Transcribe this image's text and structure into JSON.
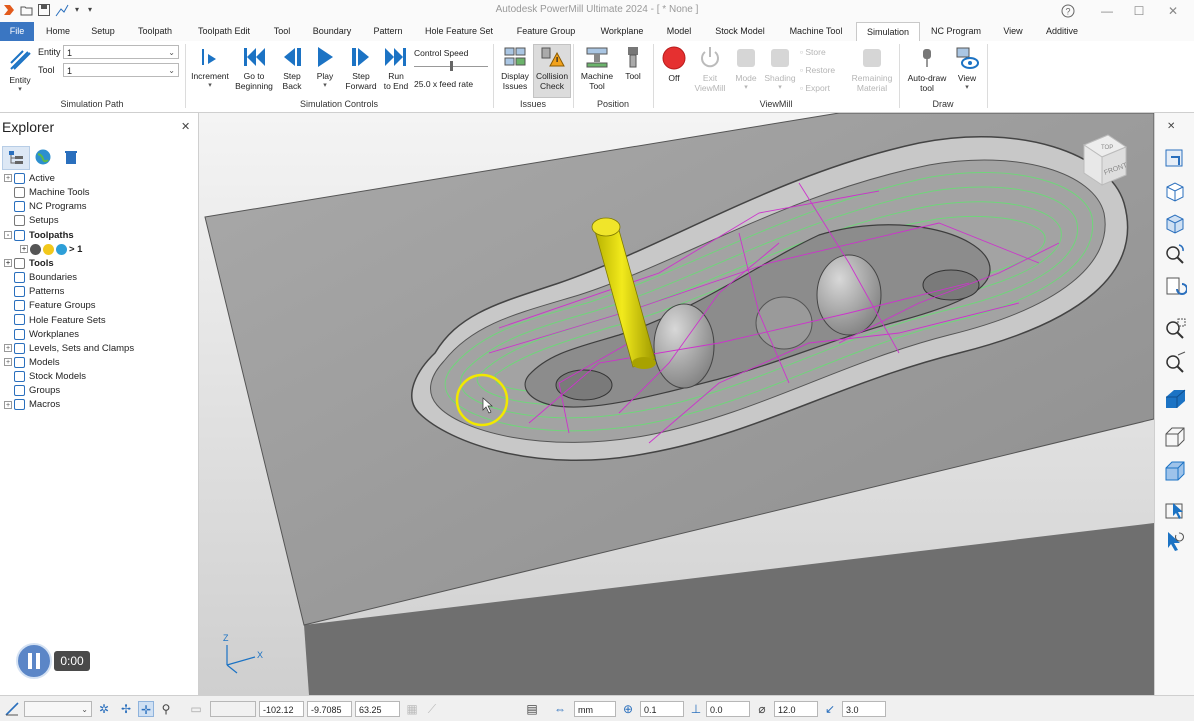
{
  "window": {
    "title": "Autodesk PowerMill Ultimate 2024  -  [ * None ]",
    "quick_access": [
      "app-logo-icon",
      "open-folder-icon",
      "save-icon",
      "graph-icon",
      "dropdown-arrow-icon"
    ],
    "controls": [
      "help-icon",
      "minimize-icon",
      "restore-icon",
      "close-icon"
    ]
  },
  "tabs": [
    {
      "label": "File"
    },
    {
      "label": "Home"
    },
    {
      "label": "Setup"
    },
    {
      "label": "Toolpath"
    },
    {
      "label": "Toolpath Edit"
    },
    {
      "label": "Tool"
    },
    {
      "label": "Boundary"
    },
    {
      "label": "Pattern"
    },
    {
      "label": "Hole Feature Set"
    },
    {
      "label": "Feature Group"
    },
    {
      "label": "Workplane"
    },
    {
      "label": "Model"
    },
    {
      "label": "Stock Model"
    },
    {
      "label": "Machine Tool"
    },
    {
      "label": "Simulation"
    },
    {
      "label": "NC Program"
    },
    {
      "label": "View"
    },
    {
      "label": "Additive"
    }
  ],
  "active_tab": "Simulation",
  "ribbon": {
    "simulation_path": {
      "group_label": "Simulation Path",
      "entity_button": "Entity",
      "entity_label": "Entity",
      "entity_value": "1",
      "tool_label": "Tool",
      "tool_value": "1"
    },
    "simulation_controls": {
      "group_label": "Simulation Controls",
      "increment": "Increment",
      "go_to_beginning": [
        "Go to",
        "Beginning"
      ],
      "step_back": [
        "Step",
        "Back"
      ],
      "play": "Play",
      "step_forward": [
        "Step",
        "Forward"
      ],
      "run_to_end": [
        "Run",
        "to End"
      ],
      "control_speed_label": "Control Speed",
      "feed_rate": "25.0 x feed rate",
      "speed_level": 0.5
    },
    "issues": {
      "group_label": "Issues",
      "display_issues": [
        "Display",
        "Issues"
      ],
      "collision_check": [
        "Collision",
        "Check"
      ]
    },
    "position": {
      "group_label": "Position",
      "machine_tool": [
        "Machine",
        "Tool"
      ],
      "tool": "Tool"
    },
    "viewmill": {
      "group_label": "ViewMill",
      "off": "Off",
      "exit_viewmill": [
        "Exit",
        "ViewMill"
      ],
      "mode": "Mode",
      "shading": "Shading",
      "store": "Store",
      "restore": "Restore",
      "export": "Export",
      "remaining_material": [
        "Remaining",
        "Material"
      ]
    },
    "draw": {
      "group_label": "Draw",
      "auto_draw_tool": [
        "Auto-draw",
        "tool"
      ],
      "view": "View"
    }
  },
  "explorer": {
    "title": "Explorer",
    "tabs": [
      "explorer-tree-icon",
      "globe-icon",
      "recycle-bin-icon"
    ],
    "items": [
      {
        "label": "Active",
        "expander": "+",
        "bold": false
      },
      {
        "label": "Machine Tools",
        "expander": "",
        "bold": false
      },
      {
        "label": "NC Programs",
        "expander": "",
        "bold": false
      },
      {
        "label": "Setups",
        "expander": "",
        "bold": false
      },
      {
        "label": "Toolpaths",
        "expander": "-",
        "bold": true
      },
      {
        "label": "> 1",
        "expander": "+",
        "bold": true
      },
      {
        "label": "Tools",
        "expander": "+",
        "bold": true
      },
      {
        "label": "Boundaries",
        "expander": "",
        "bold": false
      },
      {
        "label": "Patterns",
        "expander": "",
        "bold": false
      },
      {
        "label": "Feature Groups",
        "expander": "",
        "bold": false
      },
      {
        "label": "Hole Feature Sets",
        "expander": "",
        "bold": false
      },
      {
        "label": "Workplanes",
        "expander": "",
        "bold": false
      },
      {
        "label": "Levels, Sets and Clamps",
        "expander": "+",
        "bold": false
      },
      {
        "label": "Models",
        "expander": "+",
        "bold": false
      },
      {
        "label": "Stock Models",
        "expander": "",
        "bold": false
      },
      {
        "label": "Groups",
        "expander": "",
        "bold": false
      },
      {
        "label": "Macros",
        "expander": "+",
        "bold": false
      }
    ]
  },
  "viewport": {
    "view_cube_top": "TOP",
    "view_cube_front": "FRONT",
    "axis_z": "Z",
    "axis_x": "X"
  },
  "player": {
    "time": "0:00"
  },
  "statusbar": {
    "x": "-102.12",
    "y": "-9.7085",
    "z": "63.25",
    "units": "mm",
    "tolerance": "0.1",
    "thickness": "0.0",
    "diameter": "12.0",
    "stepdown": "3.0"
  },
  "colors": {
    "accent": "#1c73c4",
    "file_tab": "#3a76c2",
    "tool_yellow": "#d9d200",
    "toolpath_green": "#6fd67a",
    "toolpath_magenta": "#cc33cc",
    "record_red": "#e53030"
  }
}
